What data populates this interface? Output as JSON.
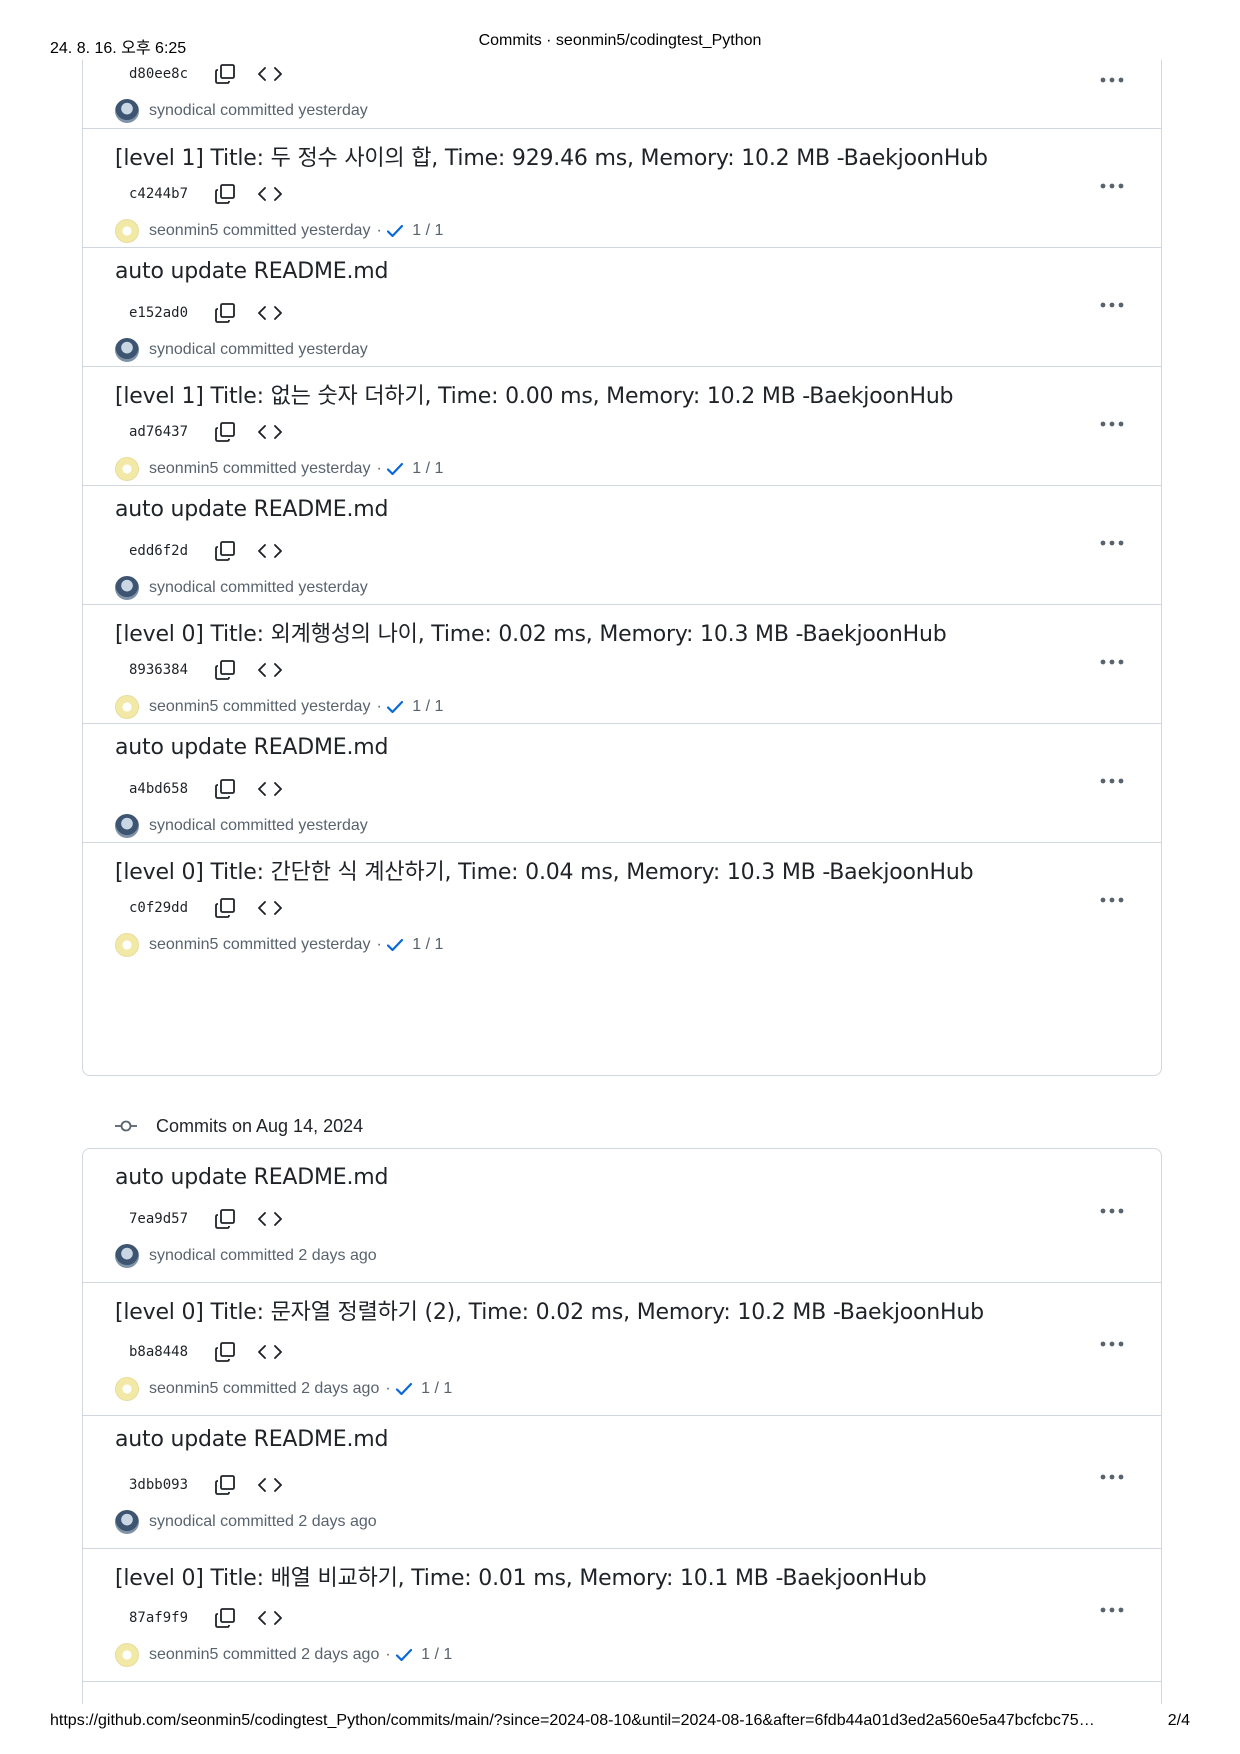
{
  "print_header": {
    "datetime": "24. 8. 16. 오후 6:25",
    "page_title": "Commits · seonmin5/codingtest_Python"
  },
  "print_footer": {
    "url": "https://github.com/seonmin5/codingtest_Python/commits/main/?since=2024-08-10&until=2024-08-16&after=6fdb44a01d3ed2a560e5a47bcfcbc75…",
    "page_number": "2/4"
  },
  "group1": {
    "commits": [
      {
        "sha": "d80ee8c",
        "author": "synodical",
        "time": "committed yesterday"
      },
      {
        "message": "[level 1] Title: 두 정수 사이의 합, Time: 929.46 ms, Memory: 10.2 MB -BaekjoonHub",
        "sha": "c4244b7",
        "author": "seonmin5",
        "time": "committed yesterday",
        "checks": "1 / 1"
      },
      {
        "message": "auto update README.md",
        "sha": "e152ad0",
        "author": "synodical",
        "time": "committed yesterday"
      },
      {
        "message": "[level 1] Title: 없는 숫자 더하기, Time: 0.00 ms, Memory: 10.2 MB -BaekjoonHub",
        "sha": "ad76437",
        "author": "seonmin5",
        "time": "committed yesterday",
        "checks": "1 / 1"
      },
      {
        "message": "auto update README.md",
        "sha": "edd6f2d",
        "author": "synodical",
        "time": "committed yesterday"
      },
      {
        "message": "[level 0] Title: 외계행성의 나이, Time: 0.02 ms, Memory: 10.3 MB -BaekjoonHub",
        "sha": "8936384",
        "author": "seonmin5",
        "time": "committed yesterday",
        "checks": "1 / 1"
      },
      {
        "message": "auto update README.md",
        "sha": "a4bd658",
        "author": "synodical",
        "time": "committed yesterday"
      },
      {
        "message": "[level 0] Title: 간단한 식 계산하기, Time: 0.04 ms, Memory: 10.3 MB -BaekjoonHub",
        "sha": "c0f29dd",
        "author": "seonmin5",
        "time": "committed yesterday",
        "checks": "1 / 1"
      }
    ]
  },
  "group2": {
    "header": "Commits on Aug 14, 2024",
    "commits": [
      {
        "message": "auto update README.md",
        "sha": "7ea9d57",
        "author": "synodical",
        "time": "committed 2 days ago"
      },
      {
        "message": "[level 0] Title: 문자열 정렬하기 (2), Time: 0.02 ms, Memory: 10.2 MB -BaekjoonHub",
        "sha": "b8a8448",
        "author": "seonmin5",
        "time": "committed 2 days ago",
        "checks": "1 / 1"
      },
      {
        "message": "auto update README.md",
        "sha": "3dbb093",
        "author": "synodical",
        "time": "committed 2 days ago"
      },
      {
        "message": "[level 0] Title: 배열 비교하기, Time: 0.01 ms, Memory: 10.1 MB -BaekjoonHub",
        "sha": "87af9f9",
        "author": "seonmin5",
        "time": "committed 2 days ago",
        "checks": "1 / 1"
      }
    ]
  },
  "icons": {
    "copy": "copy-icon",
    "browse_code": "code-icon",
    "more": "kebab-horizontal-icon",
    "check": "check-icon",
    "commit_node": "git-commit-icon"
  },
  "colors": {
    "border": "#d0d7de",
    "text": "#1f2328",
    "muted": "#59636e",
    "check": "#0969da"
  }
}
